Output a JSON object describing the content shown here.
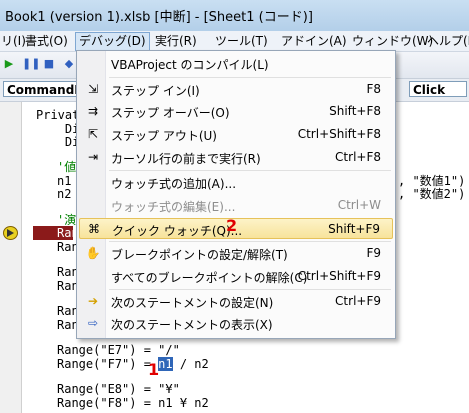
{
  "window": {
    "title": "Book1 (version 1).xlsb [中断] - [Sheet1 (コード)]"
  },
  "menubar": {
    "items": [
      {
        "label": "リ(I)"
      },
      {
        "label": "書式(O)"
      },
      {
        "label": "デバッグ(D)"
      },
      {
        "label": "実行(R)"
      },
      {
        "label": "ツール(T)"
      },
      {
        "label": "アドイン(A)"
      },
      {
        "label": "ウィンドウ(W)"
      },
      {
        "label": "ヘルプ(H)"
      }
    ]
  },
  "combos": {
    "object": "CommandB",
    "procedure": "Click"
  },
  "code": {
    "lines": [
      {
        "text": "Private"
      },
      {
        "text": "    Dim"
      },
      {
        "text": "    Dim"
      },
      {
        "text": "'値",
        "comment": true
      },
      {
        "text": "n1"
      },
      {
        "text": "n2"
      },
      {
        "text": "'演",
        "comment": true
      },
      {
        "text": "Ran"
      },
      {
        "text": "Ran"
      },
      {
        "text": "Ran"
      },
      {
        "text": "Ran"
      },
      {
        "text": "Ran"
      },
      {
        "text": "Ran"
      },
      {
        "text": "Range(\"E7\") = \"/\""
      },
      {
        "text": "Range(\"F7\") = "
      },
      {
        "text": "Range(\"E8\") = \"¥\""
      },
      {
        "text": "Range(\"F8\") = n1 ¥ n2"
      }
    ],
    "right_fragments": [
      ", \"数値1\")",
      ", \"数値2\")"
    ],
    "selected_token": "n1",
    "after_selected": " / n2"
  },
  "debug_menu": {
    "items": [
      {
        "label": "VBAProject のコンパイル(L)",
        "shortcut": "",
        "icon": "none",
        "disabled": false
      },
      {
        "label": "ステップ イン(I)",
        "shortcut": "F8",
        "icon": "step-in-icon",
        "disabled": false
      },
      {
        "label": "ステップ オーバー(O)",
        "shortcut": "Shift+F8",
        "icon": "step-over-icon",
        "disabled": false
      },
      {
        "label": "ステップ アウト(U)",
        "shortcut": "Ctrl+Shift+F8",
        "icon": "step-out-icon",
        "disabled": false
      },
      {
        "label": "カーソル行の前まで実行(R)",
        "shortcut": "Ctrl+F8",
        "icon": "run-to-cursor-icon",
        "disabled": false
      },
      {
        "label": "ウォッチ式の追加(A)...",
        "shortcut": "",
        "icon": "none",
        "disabled": false
      },
      {
        "label": "ウォッチ式の編集(E)...",
        "shortcut": "Ctrl+W",
        "icon": "none",
        "disabled": true
      },
      {
        "label": "クイック ウォッチ(Q)...",
        "shortcut": "Shift+F9",
        "icon": "glasses-icon",
        "disabled": false,
        "highlighted": true
      },
      {
        "label": "ブレークポイントの設定/解除(T)",
        "shortcut": "F9",
        "icon": "hand-icon",
        "disabled": false
      },
      {
        "label": "すべてのブレークポイントの解除(C)",
        "shortcut": "Ctrl+Shift+F9",
        "icon": "none",
        "disabled": false
      },
      {
        "label": "次のステートメントの設定(N)",
        "shortcut": "Ctrl+F9",
        "icon": "arrow-right-icon",
        "disabled": false
      },
      {
        "label": "次のステートメントの表示(X)",
        "shortcut": "",
        "icon": "show-next-icon",
        "disabled": false
      }
    ]
  },
  "annotations": {
    "one": "1",
    "two": "2"
  },
  "colors": {
    "highlight": "#f7e39b",
    "selection": "#2f66b8",
    "annotation": "#e00000"
  }
}
